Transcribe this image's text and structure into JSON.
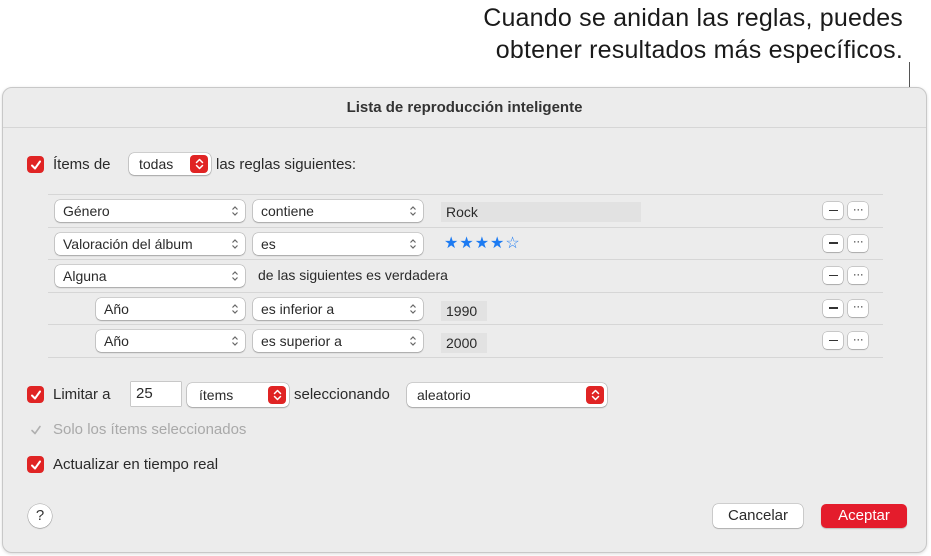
{
  "callout": {
    "line1": "Cuando se anidan las reglas, puedes",
    "line2": "obtener resultados más específicos."
  },
  "dialog": {
    "title": "Lista de reproducción inteligente",
    "match": {
      "checked": true,
      "prefix": "Ítems de",
      "selected": "todas",
      "suffix": "las reglas siguientes:"
    },
    "rules": [
      {
        "field": "Género",
        "operator": "contiene",
        "value": "Rock",
        "nested": false
      },
      {
        "field": "Valoración del álbum",
        "operator": "es",
        "rating": 4,
        "rating_max": 5,
        "nested": false
      },
      {
        "field": "Alguna",
        "operator_text": "de las siguientes es verdadera",
        "nested": false,
        "group": true
      },
      {
        "field": "Año",
        "operator": "es inferior a",
        "value": "1990",
        "nested": true
      },
      {
        "field": "Año",
        "operator": "es superior a",
        "value": "2000",
        "nested": true
      }
    ],
    "rule_buttons": {
      "remove": "−",
      "more": "···"
    },
    "limit": {
      "checked": true,
      "label": "Limitar a",
      "value": "25",
      "unit": "ítems",
      "by_label": "seleccionando",
      "by_value": "aleatorio"
    },
    "only_selected": {
      "checked": true,
      "disabled": true,
      "label": "Solo los ítems seleccionados"
    },
    "live_update": {
      "checked": true,
      "label": "Actualizar en tiempo real"
    },
    "help_label": "?",
    "cancel_label": "Cancelar",
    "ok_label": "Aceptar"
  },
  "colors": {
    "accent": "#e02424",
    "star": "#1d7bf2"
  }
}
